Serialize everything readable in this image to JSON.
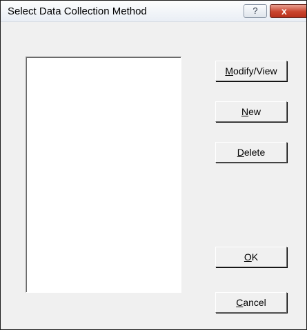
{
  "window": {
    "title": "Select Data Collection Method",
    "help_label": "?",
    "close_label": "x"
  },
  "list": {
    "items": []
  },
  "buttons": {
    "modify": {
      "mnemonic": "M",
      "rest": "odify/View"
    },
    "new": {
      "mnemonic": "N",
      "rest": "ew"
    },
    "delete": {
      "mnemonic": "D",
      "rest": "elete"
    },
    "ok": {
      "mnemonic": "O",
      "rest": "K"
    },
    "cancel": {
      "mnemonic": "C",
      "rest": "ancel"
    }
  }
}
